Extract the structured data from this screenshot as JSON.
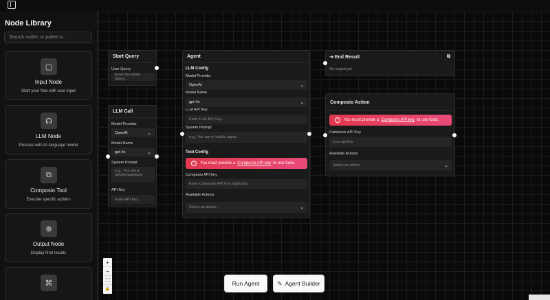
{
  "sidebar": {
    "title": "Node Library",
    "search_placeholder": "Search nodes or patterns...",
    "items": [
      {
        "title": "Input Node",
        "desc": "Start your flow with user input",
        "icon": "chat-icon"
      },
      {
        "title": "LLM Node",
        "desc": "Process with AI language model",
        "icon": "brain-icon"
      },
      {
        "title": "Composio Tool",
        "desc": "Execute specific actions",
        "icon": "tool-icon"
      },
      {
        "title": "Output Node",
        "desc": "Display final results",
        "icon": "output-icon"
      },
      {
        "title": "",
        "desc": "",
        "icon": "pattern-icon"
      }
    ]
  },
  "nodes": {
    "start_query": {
      "title": "Start Query",
      "field_label": "User Query",
      "placeholder": "Enter the initial query..."
    },
    "llm_call": {
      "title": "LLM Call",
      "provider_label": "Model Provider",
      "provider_value": "OpenAI",
      "model_label": "Model Name",
      "model_value": "gpt-4o",
      "prompt_label": "System Prompt",
      "prompt_placeholder": "e.g., You are a helpful assistant.",
      "key_label": "API Key",
      "key_placeholder": "Enter API Key..."
    },
    "agent": {
      "title": "Agent",
      "llm_section": "LLM Config",
      "provider_label": "Model Provider",
      "provider_value": "OpenAI",
      "model_label": "Model Name",
      "model_value": "gpt-4o",
      "key_label": "LLM API Key",
      "key_placeholder": "Enter LLM API Key...",
      "prompt_label": "System Prompt",
      "prompt_placeholder": "e.g., You are a helpful agent...",
      "tool_section": "Tool Config",
      "error_pre": "You must provide a",
      "error_link": "Composio API key",
      "error_post": "to use tools.",
      "composio_label": "Composio API Key",
      "composio_placeholder": "Enter Composio API Key (optional)",
      "actions_label": "Available Actions",
      "actions_placeholder": "Select an action..."
    },
    "end_result": {
      "title": "End Result",
      "output": "No output yet."
    },
    "composio_action": {
      "title": "Composio Action",
      "error_pre": "You must provide a",
      "error_link": "Composio API key",
      "error_post": "to use tools.",
      "key_label": "Composio API Key",
      "key_placeholder": "your api key",
      "actions_label": "Available Actions",
      "actions_placeholder": "Select an action..."
    }
  },
  "controls": {
    "zoom_in": "+",
    "zoom_out": "−",
    "fit": "⛶",
    "lock": "🔒"
  },
  "buttons": {
    "run": "Run Agent",
    "builder": "Agent Builder"
  }
}
